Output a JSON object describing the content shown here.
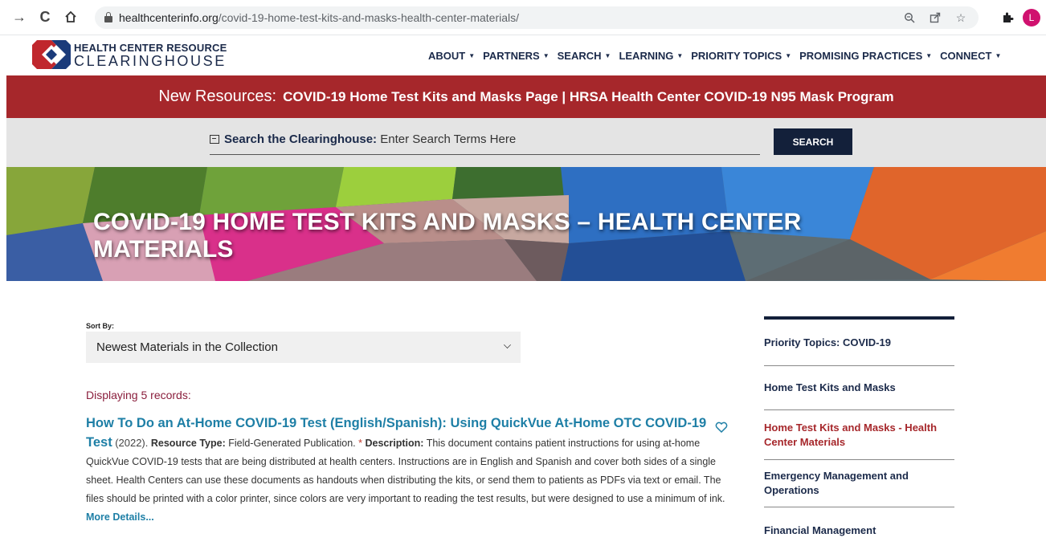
{
  "browser": {
    "url_domain": "healthcenterinfo.org",
    "url_path": "/covid-19-home-test-kits-and-masks-health-center-materials/",
    "profile_initial": "L",
    "icons": [
      "back-icon",
      "reload-icon",
      "home-icon",
      "lock-icon",
      "zoom-icon",
      "share-icon",
      "star-icon",
      "extensions-icon"
    ]
  },
  "site": {
    "logo_line1": "HEALTH CENTER RESOURCE",
    "logo_line2": "CLEARINGHOUSE",
    "nav": [
      {
        "label": "ABOUT"
      },
      {
        "label": "PARTNERS"
      },
      {
        "label": "SEARCH"
      },
      {
        "label": "LEARNING"
      },
      {
        "label": "PRIORITY TOPICS"
      },
      {
        "label": "PROMISING PRACTICES"
      },
      {
        "label": "CONNECT"
      }
    ]
  },
  "banner": {
    "lead": "New Resources:",
    "links": "COVID-19 Home Test Kits and Masks Page | HRSA Health Center COVID-19 N95 Mask Program"
  },
  "search": {
    "label": "Search the Clearinghouse:",
    "placeholder": "Enter Search Terms Here",
    "button": "SEARCH"
  },
  "hero": {
    "title": "COVID-19 HOME TEST KITS AND MASKS – HEALTH CENTER MATERIALS"
  },
  "results": {
    "sort_label": "Sort By:",
    "sort_value": "Newest Materials in the Collection",
    "count_text": "Displaying 5 records:",
    "items": [
      {
        "title": "How To Do an At-Home COVID-19 Test (English/Spanish): Using QuickVue At-Home OTC COVID-19 Test",
        "year": "(2022).",
        "type_label": "Resource Type:",
        "type_value": "Field-Generated Publication.",
        "asterisk": "*",
        "desc_label": "Description:",
        "description": "This document contains patient instructions for using at-home QuickVue COVID-19 tests that are being distributed at health centers. Instructions are in English and Spanish and cover both sides of a single sheet. Health Centers can use these documents as handouts when distributing the kits, or send them to patients as PDFs via text or email. The files should be printed with a color printer, since colors are very important to reading the test results, but were designed to use a minimum of ink.",
        "more": "More Details..."
      }
    ]
  },
  "sidebar": {
    "items": [
      {
        "label": "Priority Topics: COVID-19"
      },
      {
        "label": "Home Test Kits and Masks"
      },
      {
        "label": "Home Test Kits and Masks - Health Center Materials",
        "active": true
      },
      {
        "label": "Emergency Management and Operations"
      },
      {
        "label": "Financial Management"
      }
    ]
  },
  "colors": {
    "banner": "#a6272b",
    "navy": "#13203a",
    "link": "#1e7fa6",
    "records": "#8a1e3c"
  }
}
